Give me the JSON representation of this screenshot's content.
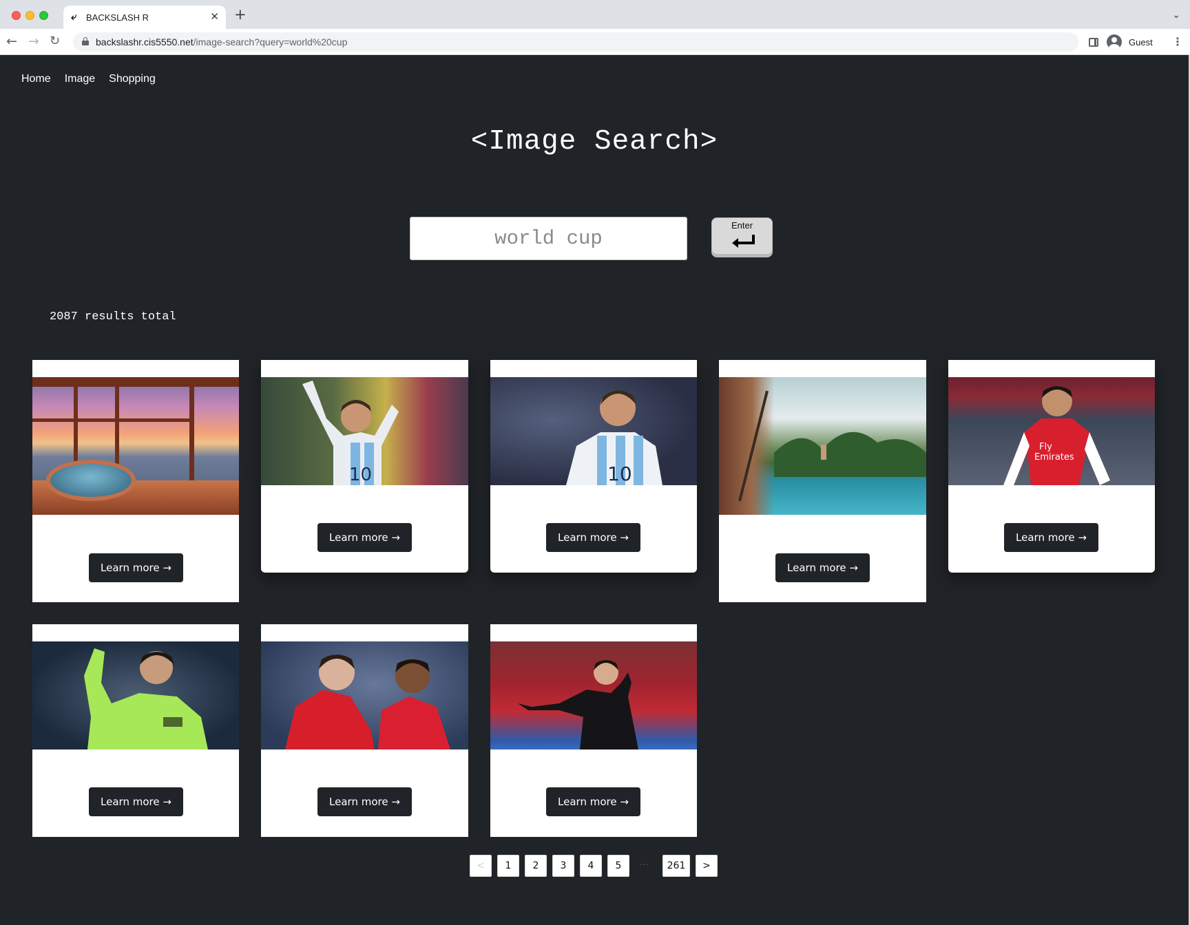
{
  "browser": {
    "tab_title": "BACKSLASH R",
    "url_host": "backslashr.cis5550.net",
    "url_path": "/image-search?query=world%20cup",
    "profile_name": "Guest"
  },
  "nav": {
    "items": [
      "Home",
      "Image",
      "Shopping"
    ]
  },
  "page": {
    "title": "<Image Search>",
    "search_value": "world cup",
    "enter_key_label": "Enter",
    "results_count": "2087 results total"
  },
  "results": [
    {
      "image": "pool-sunset-photo",
      "button": "Learn more →"
    },
    {
      "image": "messi-celebration-photo",
      "button": "Learn more →"
    },
    {
      "image": "messi-argentina-photo",
      "button": "Learn more →"
    },
    {
      "image": "infinity-pool-photo",
      "button": "Learn more →"
    },
    {
      "image": "arsenal-player-photo",
      "button": "Learn more →"
    },
    {
      "image": "ronaldo-green-kit-photo",
      "button": "Learn more →"
    },
    {
      "image": "man-utd-players-photo",
      "button": "Learn more →"
    },
    {
      "image": "juventus-player-photo",
      "button": "Learn more →"
    }
  ],
  "pagination": {
    "prev": "<",
    "pages": [
      "1",
      "2",
      "3",
      "4",
      "5"
    ],
    "ellipsis": "···",
    "last": "261",
    "next": ">"
  },
  "colors": {
    "page_bg": "#202327",
    "card_bg": "#ffffff",
    "button_bg": "#202327"
  }
}
